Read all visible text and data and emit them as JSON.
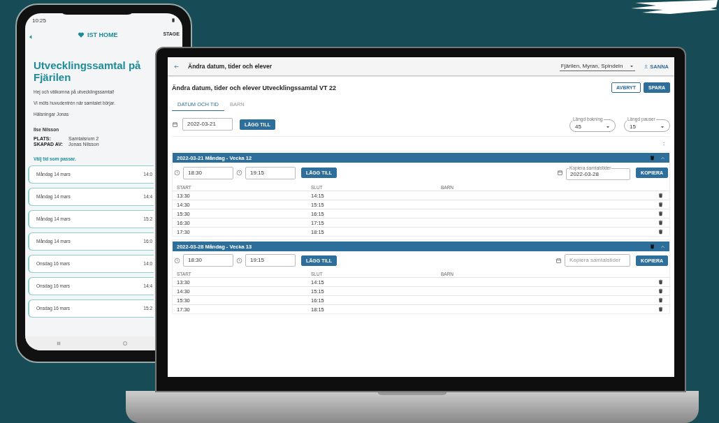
{
  "phone": {
    "status_time": "10:25",
    "stage_label": "STAGE",
    "logo": "IST HOME",
    "title": "Utvecklingssamtal på Fjärilen",
    "paragraphs": [
      "Hej och välkomna på utvecklingssamtal!",
      "Vi möts huvudentrén när samtalet börjar.",
      "Hälsningar Jonas"
    ],
    "teacher": "Ilse Nilsson",
    "details": [
      {
        "label": "PLATS:",
        "value": "Samtalsrum 2"
      },
      {
        "label": "SKAPAD AV:",
        "value": "Jonas Nilsson"
      }
    ],
    "prompt": "Välj tid som passar.",
    "slots": [
      {
        "day": "Måndag 14 mars",
        "time": "14:0"
      },
      {
        "day": "Måndag 14 mars",
        "time": "14:4"
      },
      {
        "day": "Måndag 14 mars",
        "time": "15:2"
      },
      {
        "day": "Måndag 14 mars",
        "time": "16:0"
      },
      {
        "day": "Onsdag 16 mars",
        "time": "14:0"
      },
      {
        "day": "Onsdag 16 mars",
        "time": "14:4"
      },
      {
        "day": "Onsdag 16 mars",
        "time": "15:2"
      }
    ]
  },
  "laptop": {
    "app_bar": {
      "title": "Ändra datum, tider och elever",
      "class_select": "Fjärilen, Myran, Spindeln",
      "user": "SANNA"
    },
    "page_title": "Ändra datum, tider och elever Utvecklingssamtal VT 22",
    "buttons": [
      {
        "label": "AVBRYT",
        "kind": "outlined"
      },
      {
        "label": "SPARA",
        "kind": "filled"
      }
    ],
    "tabs": [
      {
        "label": "DATUM OCH TID",
        "selected": true
      },
      {
        "label": "BARN",
        "selected": false
      }
    ],
    "date_field": {
      "value": "2022-03-21"
    },
    "add_button": "LÄGG TILL",
    "selects": [
      {
        "label": "Längd bokning",
        "value": "45"
      },
      {
        "label": "Längd pauser",
        "value": "15"
      }
    ],
    "sections": [
      {
        "title": "2022-03-21 Måndag - Vecka 12",
        "expanded": true,
        "start_time": "18:30",
        "end_time": "19:15",
        "add_button": "LÄGG TILL",
        "copy_field": {
          "label": "Kopiera samtalstider",
          "value": "2022-03-28"
        },
        "copy_button": "KOPIERA",
        "columns": [
          "START",
          "SLUT",
          "BARN"
        ],
        "rows": [
          {
            "start": "13:30",
            "end": "14:15"
          },
          {
            "start": "14:30",
            "end": "15:15"
          },
          {
            "start": "15:30",
            "end": "16:15"
          },
          {
            "start": "16:30",
            "end": "17:15"
          },
          {
            "start": "17:30",
            "end": "18:15"
          }
        ]
      },
      {
        "title": "2022-03-28 Måndag - Vecka 13",
        "expanded": true,
        "start_time": "18:30",
        "end_time": "19:15",
        "add_button": "LÄGG TILL",
        "copy_field": {
          "placeholder": "Kopiera samtalstider"
        },
        "copy_button": "KOPIERA",
        "columns": [
          "START",
          "SLUT",
          "BARN"
        ],
        "rows": [
          {
            "start": "13:30",
            "end": "14:15"
          },
          {
            "start": "14:30",
            "end": "15:15"
          },
          {
            "start": "15:30",
            "end": "16:15"
          },
          {
            "start": "17:30",
            "end": "18:15"
          }
        ]
      }
    ]
  }
}
